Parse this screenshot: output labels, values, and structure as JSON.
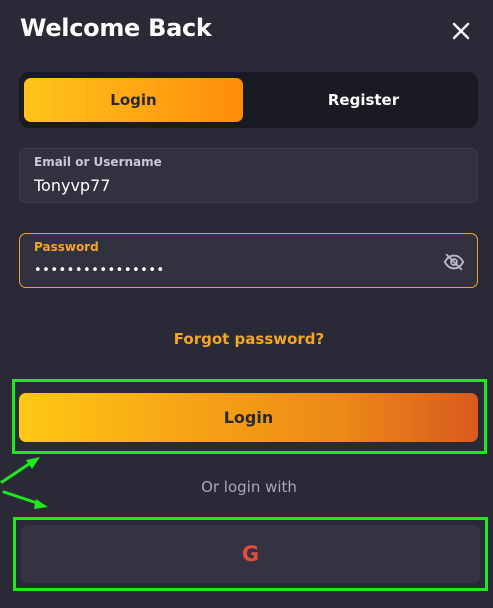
{
  "header": {
    "title": "Welcome Back",
    "close_icon": "close-icon"
  },
  "tabs": {
    "login_label": "Login",
    "register_label": "Register",
    "active": "Login"
  },
  "email_field": {
    "label": "Email or Username",
    "value": "Tonyvp77"
  },
  "password_field": {
    "label": "Password",
    "value": "••••••••••••••••",
    "visibility_icon": "eye-off-icon"
  },
  "forgot_password": "Forgot password?",
  "login_button": "Login",
  "divider_text": "Or login with",
  "social": {
    "google_label": "G",
    "google_icon": "google-icon"
  },
  "annotations": {
    "highlight_color": "#1ee81e"
  },
  "colors": {
    "background": "#2a2a37",
    "accent": "#f5a623",
    "tab_bar": "#1a1a22",
    "field_bg": "#31313f",
    "google_red": "#e84b3a"
  }
}
